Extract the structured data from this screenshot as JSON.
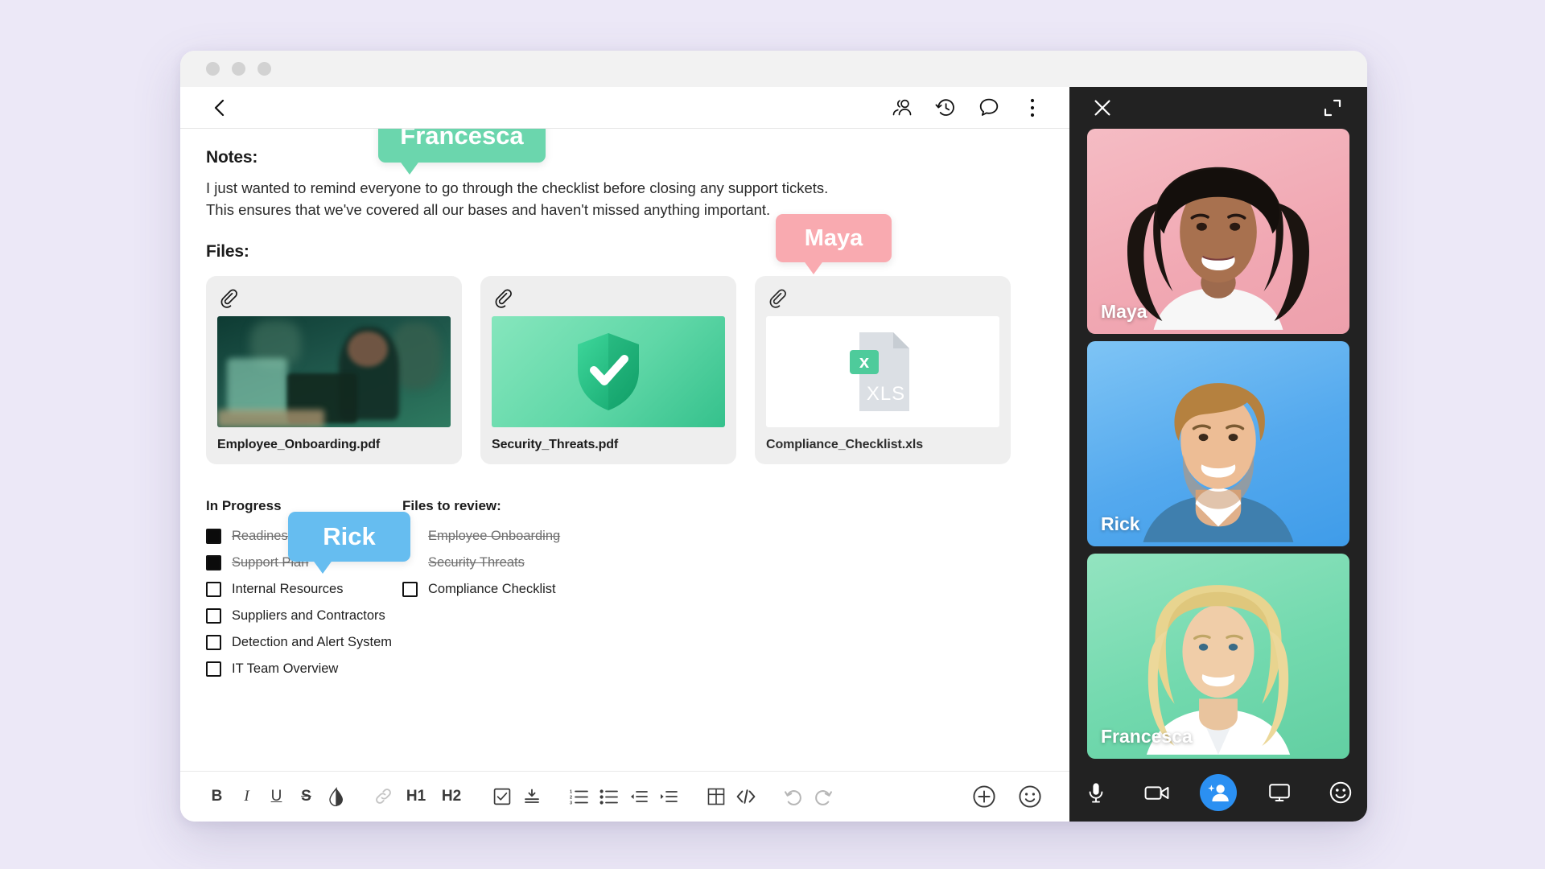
{
  "window": {
    "traffic_lights": [
      "close",
      "minimize",
      "maximize"
    ]
  },
  "doc_header": {
    "back_label": "back",
    "icons": [
      {
        "name": "people-icon",
        "label": "Participants"
      },
      {
        "name": "history-icon",
        "label": "Version history"
      },
      {
        "name": "chat-icon",
        "label": "Comments"
      },
      {
        "name": "more-icon",
        "label": "More options"
      }
    ]
  },
  "document": {
    "notes_heading": "Notes:",
    "notes_line1": "I just wanted to remind everyone to go through the checklist before closing any support tickets.",
    "notes_line2": "This ensures that we've covered all our bases and haven't missed anything important.",
    "files_heading": "Files:",
    "files": [
      {
        "name": "Employee_Onboarding.pdf",
        "thumb": "office-photo",
        "icon": "paperclip-icon"
      },
      {
        "name": "Security_Threats.pdf",
        "thumb": "shield-graphic",
        "icon": "paperclip-icon"
      },
      {
        "name": "Compliance_Checklist.xls",
        "thumb": "xls-file-icon",
        "icon": "paperclip-icon"
      }
    ],
    "lists": [
      {
        "title": "In Progress",
        "items": [
          {
            "label": "Readiness Assessment",
            "checked": true
          },
          {
            "label": "Support Plan",
            "checked": true
          },
          {
            "label": "Internal Resources",
            "checked": false
          },
          {
            "label": "Suppliers and Contractors",
            "checked": false
          },
          {
            "label": "Detection and Alert System",
            "checked": false
          },
          {
            "label": "IT Team Overview",
            "checked": false
          }
        ]
      },
      {
        "title": "Files to review:",
        "items": [
          {
            "label": "Employee Onboarding",
            "checked": true
          },
          {
            "label": "Security Threats",
            "checked": true
          },
          {
            "label": "Compliance Checklist",
            "checked": false
          }
        ]
      }
    ]
  },
  "cursors": [
    {
      "name": "Francesca",
      "color": "#6bd6ad"
    },
    {
      "name": "Maya",
      "color": "#f9aab0"
    },
    {
      "name": "Rick",
      "color": "#66bdf0"
    }
  ],
  "toolbar": {
    "items": [
      {
        "name": "bold-button",
        "label": "B"
      },
      {
        "name": "italic-button",
        "label": "I"
      },
      {
        "name": "underline-button",
        "label": "U"
      },
      {
        "name": "strikethrough-button",
        "label": "S"
      },
      {
        "name": "highlight-color-button",
        "label": "ink-drop-icon"
      },
      {
        "name": "link-button",
        "label": "link-icon"
      },
      {
        "name": "heading-1-button",
        "label": "H1"
      },
      {
        "name": "heading-2-button",
        "label": "H2"
      },
      {
        "name": "checklist-button",
        "label": "checkbox-icon"
      },
      {
        "name": "collapse-button",
        "label": "collapse-icon"
      },
      {
        "name": "numbered-list-button",
        "label": "numbered-list-icon"
      },
      {
        "name": "bulleted-list-button",
        "label": "bulleted-list-icon"
      },
      {
        "name": "outdent-button",
        "label": "outdent-icon"
      },
      {
        "name": "indent-button",
        "label": "indent-icon"
      },
      {
        "name": "table-button",
        "label": "table-icon"
      },
      {
        "name": "code-button",
        "label": "code-icon"
      },
      {
        "name": "undo-button",
        "label": "undo-icon"
      },
      {
        "name": "redo-button",
        "label": "redo-icon"
      }
    ],
    "add_label": "plus-circle-icon",
    "emoji_label": "smiley-icon"
  },
  "call": {
    "close_label": "close-icon",
    "expand_label": "expand-icon",
    "participants": [
      {
        "name": "Maya",
        "bg": "#f1a8b3"
      },
      {
        "name": "Rick",
        "bg": "#54a9ee"
      },
      {
        "name": "Francesca",
        "bg": "#72d9ae"
      }
    ],
    "controls": [
      {
        "name": "microphone-button",
        "icon": "microphone-icon",
        "active": false
      },
      {
        "name": "camera-button",
        "icon": "video-camera-icon",
        "active": false
      },
      {
        "name": "add-participant-button",
        "icon": "add-person-icon",
        "active": true
      },
      {
        "name": "share-screen-button",
        "icon": "monitor-icon",
        "active": false
      },
      {
        "name": "reactions-button",
        "icon": "smiley-icon",
        "active": false
      }
    ],
    "accent_color": "#2b90f2"
  }
}
